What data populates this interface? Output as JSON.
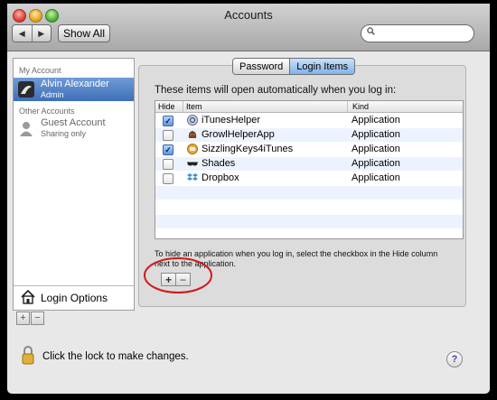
{
  "window": {
    "title": "Accounts"
  },
  "toolbar": {
    "back_glyph": "◀",
    "forward_glyph": "▶",
    "show_all_label": "Show All",
    "search_placeholder": ""
  },
  "sidebar": {
    "my_account_heading": "My Account",
    "other_accounts_heading": "Other Accounts",
    "accounts": [
      {
        "name": "Alvin Alexander",
        "role": "Admin",
        "selected": true
      },
      {
        "name": "Guest Account",
        "role": "Sharing only",
        "selected": false
      }
    ],
    "login_options_label": "Login Options",
    "add_glyph": "+",
    "remove_glyph": "−"
  },
  "tabs": [
    {
      "label": "Password",
      "active": false
    },
    {
      "label": "Login Items",
      "active": true
    }
  ],
  "login_items": {
    "intro": "These items will open automatically when you log in:",
    "columns": [
      "Hide",
      "Item",
      "Kind"
    ],
    "rows": [
      {
        "hide": true,
        "name": "iTunesHelper",
        "kind": "Application",
        "icon": "itunes-helper-icon"
      },
      {
        "hide": false,
        "name": "GrowlHelperApp",
        "kind": "Application",
        "icon": "growl-icon"
      },
      {
        "hide": true,
        "name": "SizzlingKeys4iTunes",
        "kind": "Application",
        "icon": "sizzlingkeys-icon"
      },
      {
        "hide": false,
        "name": "Shades",
        "kind": "Application",
        "icon": "shades-icon"
      },
      {
        "hide": false,
        "name": "Dropbox",
        "kind": "Application",
        "icon": "dropbox-icon"
      }
    ],
    "hint": "To hide an application when you log in, select the checkbox in the Hide column next to the application.",
    "add_glyph": "+",
    "remove_glyph": "−",
    "check_glyph": "✓"
  },
  "footer": {
    "lock_text": "Click the lock to make changes.",
    "help_glyph": "?"
  },
  "colors": {
    "selection": "#3e6fb8",
    "annotation_circle": "#d11a1a",
    "tab_active": "#7fb2ea"
  }
}
